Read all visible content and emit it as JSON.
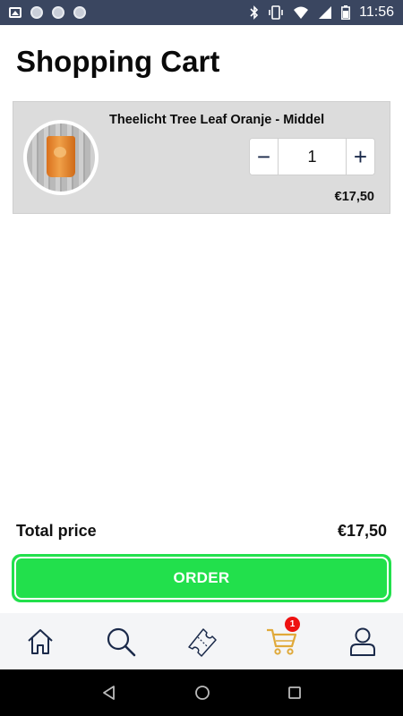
{
  "status_bar": {
    "time": "11:56",
    "left_icons": [
      "image-icon",
      "dot-icon",
      "dot-icon",
      "dot-icon"
    ],
    "right_icons": [
      "bluetooth-icon",
      "vibrate-icon",
      "wifi-icon",
      "signal-icon",
      "battery-icon"
    ]
  },
  "page": {
    "title": "Shopping Cart"
  },
  "cart": {
    "items": [
      {
        "name": "Theelicht Tree Leaf Oranje - Middel",
        "quantity": "1",
        "minus_label": "−",
        "plus_label": "+",
        "price": "€17,50"
      }
    ]
  },
  "summary": {
    "total_label": "Total price",
    "total_value": "€17,50"
  },
  "order_button": {
    "label": "ORDER"
  },
  "bottom_nav": {
    "items": [
      {
        "icon": "home-icon"
      },
      {
        "icon": "search-icon"
      },
      {
        "icon": "ticket-icon"
      },
      {
        "icon": "cart-icon",
        "badge": "1"
      },
      {
        "icon": "profile-icon"
      }
    ]
  },
  "colors": {
    "status_bar": "#3a4660",
    "order_button": "#22e04c",
    "nav_icon": "#1b2a4a",
    "nav_active": "#e0a93a",
    "badge": "#ee1111"
  }
}
